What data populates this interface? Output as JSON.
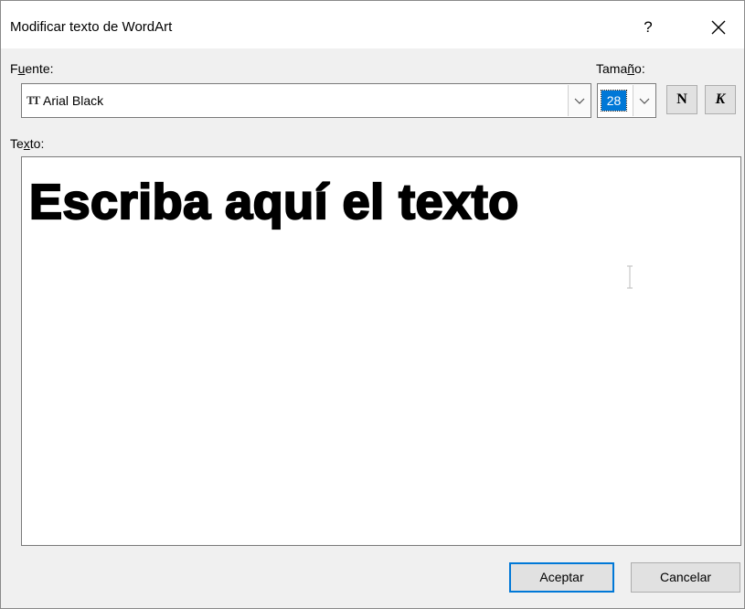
{
  "window": {
    "title": "Modificar texto de WordArt",
    "help_label": "?",
    "close_icon": "close-icon"
  },
  "font": {
    "label_pre": "F",
    "label_underlined": "u",
    "label_post": "ente:",
    "value": "Arial Black",
    "type_icon": "truetype-font-icon",
    "type_icon_glyph": "TT"
  },
  "size": {
    "label_pre": "Tama",
    "label_underlined": "ñ",
    "label_post": "o:",
    "value": "28"
  },
  "style_buttons": {
    "bold_label": "N",
    "italic_label": "K"
  },
  "text": {
    "label_pre": "Te",
    "label_underlined": "x",
    "label_post": "to:",
    "value": "Escriba aquí el texto"
  },
  "buttons": {
    "ok": "Aceptar",
    "cancel": "Cancelar"
  },
  "colors": {
    "accent": "#0078d7",
    "dialog_bg": "#f0f0f0",
    "field_border": "#7a7a7a"
  }
}
